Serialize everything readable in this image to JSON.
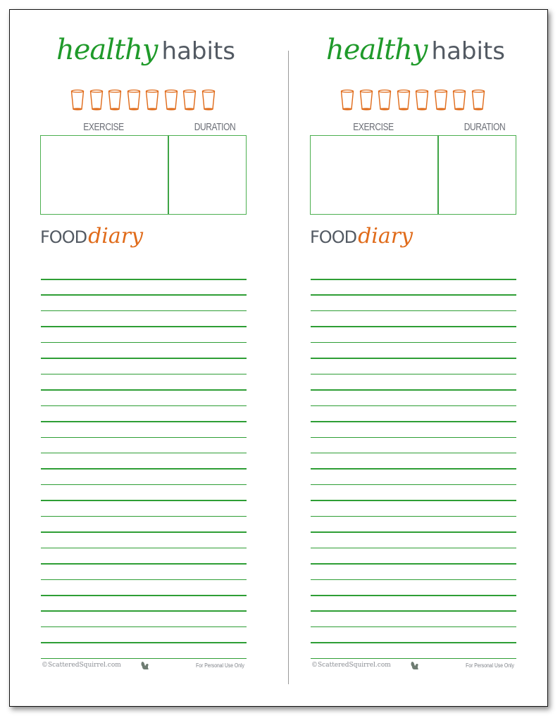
{
  "panels": [
    {
      "title_script": "healthy",
      "title_plain": "habits",
      "water_cups": 8,
      "exercise_header": "EXERCISE",
      "duration_header": "DURATION",
      "food_plain": "FOOD",
      "food_script": "diary",
      "food_lines": 25,
      "footer_copyright": "©ScatteredSquirrel.com",
      "footer_icon": "squirrel-icon",
      "footer_note": "For Personal Use Only"
    },
    {
      "title_script": "healthy",
      "title_plain": "habits",
      "water_cups": 8,
      "exercise_header": "EXERCISE",
      "duration_header": "DURATION",
      "food_plain": "FOOD",
      "food_script": "diary",
      "food_lines": 25,
      "footer_copyright": "©ScatteredSquirrel.com",
      "footer_icon": "squirrel-icon",
      "footer_note": "For Personal Use Only"
    }
  ],
  "colors": {
    "green": "#1f9a2a",
    "orange": "#e06b1a",
    "gray_text": "#535a63",
    "line_green": "#2e9e35"
  }
}
